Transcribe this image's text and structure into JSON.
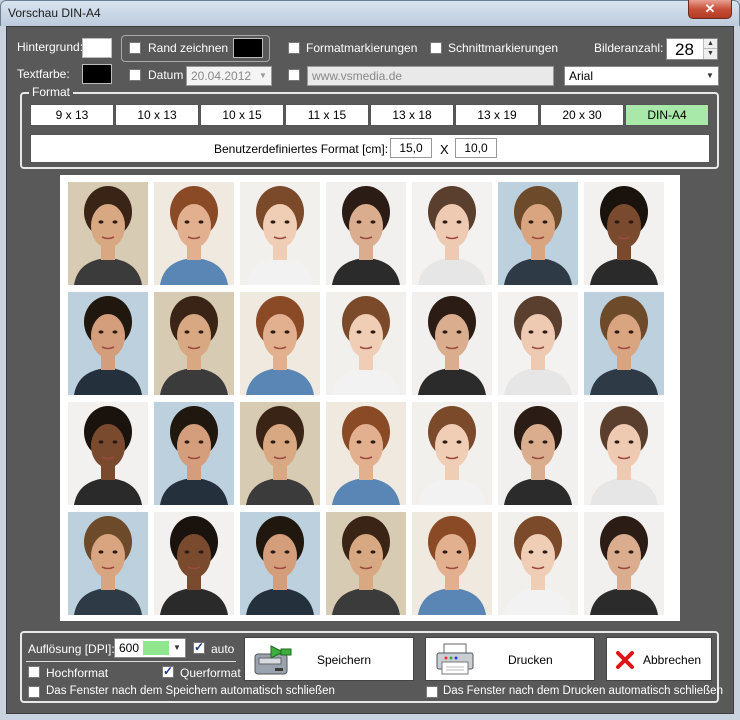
{
  "window": {
    "title": "Vorschau DIN-A4",
    "close_glyph": "✕"
  },
  "top": {
    "hintergrund_label": "Hintergrund:",
    "textfarbe_label": "Textfarbe:",
    "hintergrund_color": "#ffffff",
    "textfarbe_color": "#000000",
    "rand_label": "Rand zeichnen",
    "rand_color": "#000000",
    "rand_checked": false,
    "formatmarkierungen_label": "Formatmarkierungen",
    "schnittmarkierungen_label": "Schnittmarkierungen",
    "bilderanzahl_label": "Bilderanzahl:",
    "bilderanzahl_value": "28",
    "datum_label": "Datum",
    "datum_value": "20.04.2012",
    "url_value": "www.vsmedia.de",
    "font_value": "Arial"
  },
  "format": {
    "legend": "Format",
    "buttons": [
      "9 x 13",
      "10 x 13",
      "10 x 15",
      "11 x 15",
      "13 x 18",
      "13 x 19",
      "20 x 30",
      "DIN-A4"
    ],
    "active": "DIN-A4",
    "custom_label": "Benutzerdefiniertes Format [cm]:",
    "custom_width": "15,0",
    "custom_x": "X",
    "custom_height": "10,0"
  },
  "bottom": {
    "aufloesung_label": "Auflösung [DPI]:",
    "dpi_value": "600",
    "auto_label": "auto",
    "auto_checked": true,
    "hochformat_label": "Hochformat",
    "querformat_label": "Querformat",
    "querformat_checked": true,
    "close_after_save_label": "Das Fenster nach dem Speichern automatisch schließen",
    "close_after_print_label": "Das Fenster nach dem Drucken automatisch schließen",
    "save_button": "Speichern",
    "print_button": "Drucken",
    "cancel_button": "Abbrechen"
  },
  "photos": {
    "rows": 4,
    "cols": 7,
    "items": [
      {
        "bg": "#d8cbb4",
        "skin": "#d7a882",
        "hair": "#3a2416",
        "shirt": "#3b3b3b"
      },
      {
        "bg": "#efe9e0",
        "skin": "#e2b08e",
        "hair": "#8a4a26",
        "shirt": "#5a86b5"
      },
      {
        "bg": "#f2f0ed",
        "skin": "#f0cdb5",
        "hair": "#7b4a2a",
        "shirt": "#f2f2f2"
      },
      {
        "bg": "#f2f0ee",
        "skin": "#d9ad8e",
        "hair": "#2b1d15",
        "shirt": "#2b2b2b"
      },
      {
        "bg": "#f4f2f0",
        "skin": "#efcab2",
        "hair": "#5a3e2e",
        "shirt": "#e6e6e6"
      },
      {
        "bg": "#bcd0dd",
        "skin": "#d9a581",
        "hair": "#6c4a2a",
        "shirt": "#2e3a46"
      },
      {
        "bg": "#f3f1ef",
        "skin": "#7a4a2e",
        "hair": "#1a120c",
        "shirt": "#2a2a2a"
      },
      {
        "bg": "#bcd0dd",
        "skin": "#d49e7c",
        "hair": "#20170f",
        "shirt": "#24313c"
      },
      {
        "bg": "#d8cbb4",
        "skin": "#d7a882",
        "hair": "#3a2416",
        "shirt": "#3b3b3b"
      },
      {
        "bg": "#efe9e0",
        "skin": "#e2b08e",
        "hair": "#8a4a26",
        "shirt": "#5a86b5"
      },
      {
        "bg": "#f2f0ed",
        "skin": "#f0cdb5",
        "hair": "#7b4a2a",
        "shirt": "#f2f2f2"
      },
      {
        "bg": "#f2f0ee",
        "skin": "#d9ad8e",
        "hair": "#2b1d15",
        "shirt": "#2b2b2b"
      },
      {
        "bg": "#f4f2f0",
        "skin": "#efcab2",
        "hair": "#5a3e2e",
        "shirt": "#e6e6e6"
      },
      {
        "bg": "#bcd0dd",
        "skin": "#d9a581",
        "hair": "#6c4a2a",
        "shirt": "#2e3a46"
      },
      {
        "bg": "#f3f1ef",
        "skin": "#7a4a2e",
        "hair": "#1a120c",
        "shirt": "#2a2a2a"
      },
      {
        "bg": "#bcd0dd",
        "skin": "#d49e7c",
        "hair": "#20170f",
        "shirt": "#24313c"
      },
      {
        "bg": "#d8cbb4",
        "skin": "#d7a882",
        "hair": "#3a2416",
        "shirt": "#3b3b3b"
      },
      {
        "bg": "#efe9e0",
        "skin": "#e2b08e",
        "hair": "#8a4a26",
        "shirt": "#5a86b5"
      },
      {
        "bg": "#f2f0ed",
        "skin": "#f0cdb5",
        "hair": "#7b4a2a",
        "shirt": "#f2f2f2"
      },
      {
        "bg": "#f2f0ee",
        "skin": "#d9ad8e",
        "hair": "#2b1d15",
        "shirt": "#2b2b2b"
      },
      {
        "bg": "#f4f2f0",
        "skin": "#efcab2",
        "hair": "#5a3e2e",
        "shirt": "#e6e6e6"
      },
      {
        "bg": "#bcd0dd",
        "skin": "#d9a581",
        "hair": "#6c4a2a",
        "shirt": "#2e3a46"
      },
      {
        "bg": "#f3f1ef",
        "skin": "#7a4a2e",
        "hair": "#1a120c",
        "shirt": "#2a2a2a"
      },
      {
        "bg": "#bcd0dd",
        "skin": "#d49e7c",
        "hair": "#20170f",
        "shirt": "#24313c"
      },
      {
        "bg": "#d8cbb4",
        "skin": "#d7a882",
        "hair": "#3a2416",
        "shirt": "#3b3b3b"
      },
      {
        "bg": "#efe9e0",
        "skin": "#e2b08e",
        "hair": "#8a4a26",
        "shirt": "#5a86b5"
      },
      {
        "bg": "#f2f0ed",
        "skin": "#f0cdb5",
        "hair": "#7b4a2a",
        "shirt": "#f2f2f2"
      },
      {
        "bg": "#f2f0ee",
        "skin": "#d9ad8e",
        "hair": "#2b1d15",
        "shirt": "#2b2b2b"
      }
    ]
  },
  "icons": {
    "save": "disk-save-icon",
    "print": "printer-icon",
    "cancel": "red-x-icon"
  }
}
